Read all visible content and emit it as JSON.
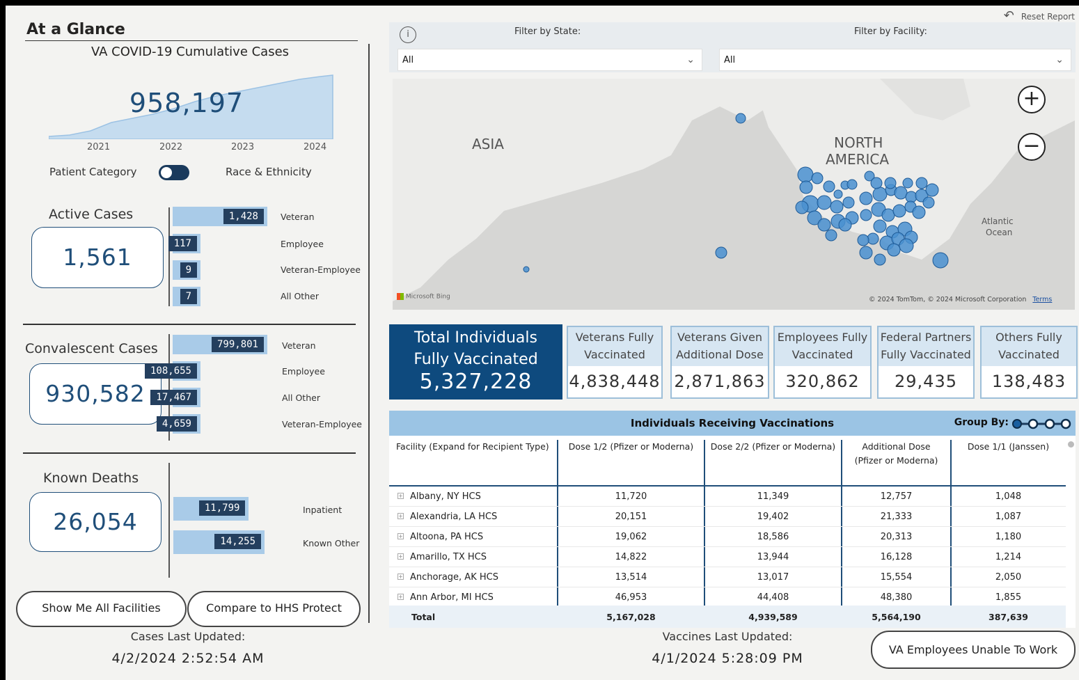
{
  "header": {
    "title": "At a Glance",
    "reset_label": "Reset Report"
  },
  "cumulative": {
    "title": "VA COVID-19 Cumulative Cases",
    "value": "958,197",
    "years": [
      "2021",
      "2022",
      "2023",
      "2024"
    ]
  },
  "toggle": {
    "left_label": "Patient Category",
    "right_label": "Race & Ethnicity"
  },
  "active": {
    "title": "Active Cases",
    "total": "1,561",
    "bars": [
      {
        "value": "1,428",
        "label": "Veteran",
        "fraction": 1.0
      },
      {
        "value": "117",
        "label": "Employee",
        "fraction": 0.082
      },
      {
        "value": "9",
        "label": "Veteran-Employee",
        "fraction": 0.006
      },
      {
        "value": "7",
        "label": "All Other",
        "fraction": 0.005
      }
    ]
  },
  "convalescent": {
    "title": "Convalescent Cases",
    "total": "930,582",
    "bars": [
      {
        "value": "799,801",
        "label": "Veteran",
        "fraction": 1.0
      },
      {
        "value": "108,655",
        "label": "Employee",
        "fraction": 0.136
      },
      {
        "value": "17,467",
        "label": "All Other",
        "fraction": 0.022
      },
      {
        "value": "4,659",
        "label": "Veteran-Employee",
        "fraction": 0.006
      }
    ]
  },
  "deaths": {
    "title": "Known Deaths",
    "total": "26,054",
    "bars": [
      {
        "value": "11,799",
        "label": "Inpatient",
        "fraction": 0.828
      },
      {
        "value": "14,255",
        "label": "Known Other",
        "fraction": 1.0
      }
    ]
  },
  "buttons": {
    "show_all": "Show Me All Facilities",
    "compare": "Compare to HHS Protect",
    "employees_unable": "VA Employees Unable To Work"
  },
  "cases_updated": {
    "label": "Cases Last Updated:",
    "value": "4/2/2024 2:52:54 AM"
  },
  "vaccines_updated": {
    "label": "Vaccines Last Updated:",
    "value": "4/1/2024 5:28:09 PM"
  },
  "filters": {
    "state_label": "Filter by State:",
    "state_value": "All",
    "facility_label": "Filter by Facility:",
    "facility_value": "All"
  },
  "map": {
    "label_asia": "ASIA",
    "label_na_1": "NORTH",
    "label_na_2": "AMERICA",
    "label_ocean_1": "Atlantic",
    "label_ocean_2": "Ocean",
    "bing": "Microsoft Bing",
    "copyright": "© 2024 TomTom, © 2024 Microsoft Corporation",
    "terms": "Terms",
    "marker_color": "#4a90d0"
  },
  "kpis": {
    "main": {
      "line1": "Total Individuals",
      "line2": "Fully Vaccinated",
      "value": "5,327,228"
    },
    "items": [
      {
        "line1": "Veterans Fully",
        "line2": "Vaccinated",
        "value": "4,838,448"
      },
      {
        "line1": "Veterans Given",
        "line2": "Additional Dose",
        "value": "2,871,863"
      },
      {
        "line1": "Employees Fully",
        "line2": "Vaccinated",
        "value": "320,862"
      },
      {
        "line1": "Federal Partners",
        "line2": "Fully Vaccinated",
        "value": "29,435"
      },
      {
        "line1": "Others Fully",
        "line2": "Vaccinated",
        "value": "138,483"
      }
    ]
  },
  "table": {
    "title": "Individuals Receiving Vaccinations",
    "group_by": "Group By:",
    "columns": [
      "Facility (Expand for Recipient Type)",
      "Dose 1/2 (Pfizer or Moderna)",
      "Dose 2/2 (Pfizer or Moderna)",
      "Additional Dose",
      "(Pfizer or Moderna)",
      "Dose 1/1 (Janssen)"
    ],
    "rows": [
      {
        "facility": "Albany, NY HCS",
        "d1": "11,720",
        "d2": "11,349",
        "add": "12,757",
        "j": "1,048"
      },
      {
        "facility": "Alexandria, LA HCS",
        "d1": "20,151",
        "d2": "19,402",
        "add": "21,333",
        "j": "1,087"
      },
      {
        "facility": "Altoona, PA HCS",
        "d1": "19,062",
        "d2": "18,586",
        "add": "20,313",
        "j": "1,180"
      },
      {
        "facility": "Amarillo, TX HCS",
        "d1": "14,822",
        "d2": "13,944",
        "add": "16,128",
        "j": "1,214"
      },
      {
        "facility": "Anchorage, AK HCS",
        "d1": "13,514",
        "d2": "13,017",
        "add": "15,554",
        "j": "2,050"
      },
      {
        "facility": "Ann Arbor, MI HCS",
        "d1": "46,953",
        "d2": "44,408",
        "add": "48,380",
        "j": "1,855"
      }
    ],
    "total": {
      "label": "Total",
      "d1": "5,167,028",
      "d2": "4,939,589",
      "add": "5,564,190",
      "j": "387,639"
    }
  }
}
